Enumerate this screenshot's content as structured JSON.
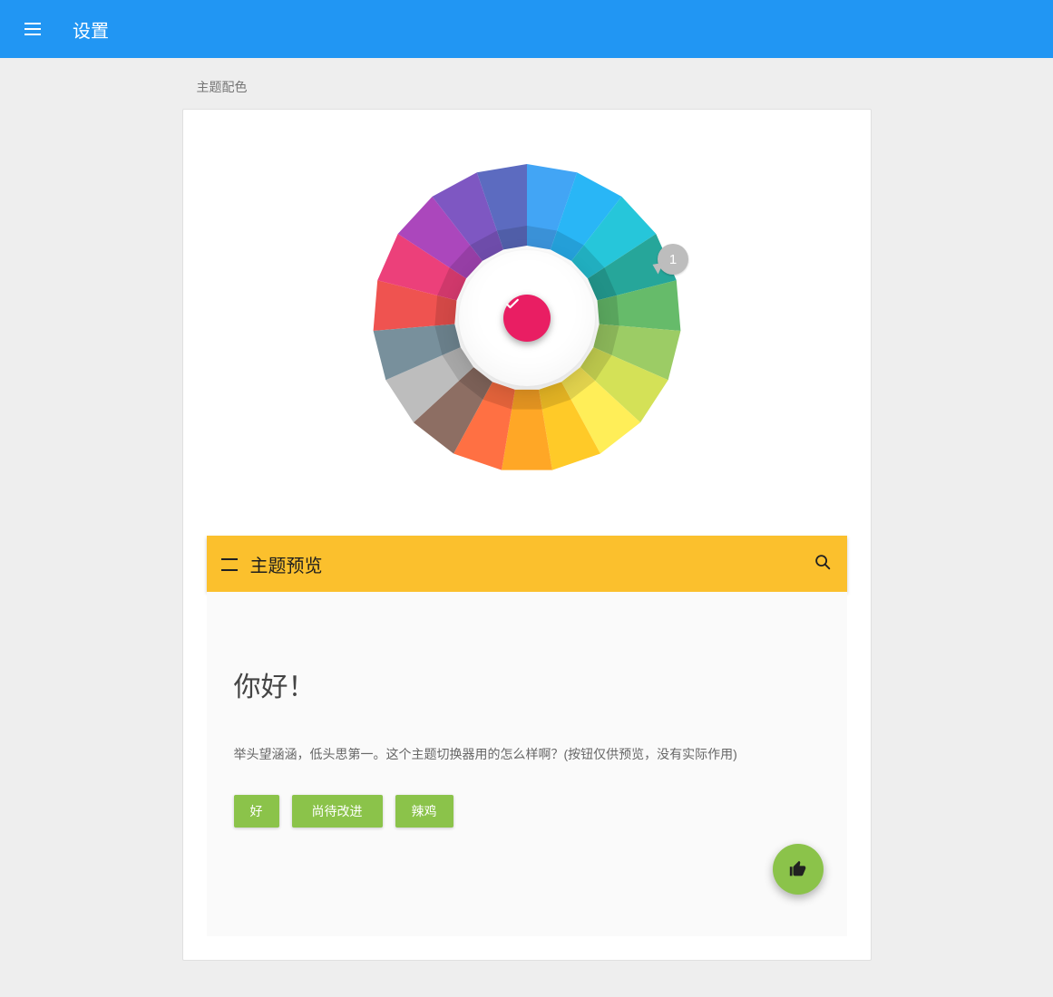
{
  "header": {
    "title": "设置"
  },
  "section_label": "主题配色",
  "wheel": {
    "colors": [
      "#ef5350",
      "#ec407a",
      "#ab47bc",
      "#7e57c2",
      "#5c6bc0",
      "#42a5f5",
      "#29b6f6",
      "#26c6da",
      "#26a69a",
      "#66bb6a",
      "#9ccc65",
      "#d4e157",
      "#ffee58",
      "#ffca28",
      "#ffa726",
      "#ff7043",
      "#8d6e63",
      "#bdbdbd",
      "#78909c"
    ],
    "badge": "1"
  },
  "preview_bar": {
    "title": "主题预览"
  },
  "preview": {
    "hello": "你好！",
    "desc": "举头望涵涵，低头思第一。这个主题切换器用的怎么样啊？(按钮仅供预览，没有实际作用)",
    "buttons": [
      "好",
      "尚待改进",
      "辣鸡"
    ]
  },
  "icons": {
    "menu": "menu-icon",
    "check": "check-icon",
    "search": "search-icon",
    "thumb_up": "thumb-up-icon"
  },
  "accent": "#e91e63",
  "preview_accent": "#8bc34a",
  "preview_primary": "#fbc02d"
}
